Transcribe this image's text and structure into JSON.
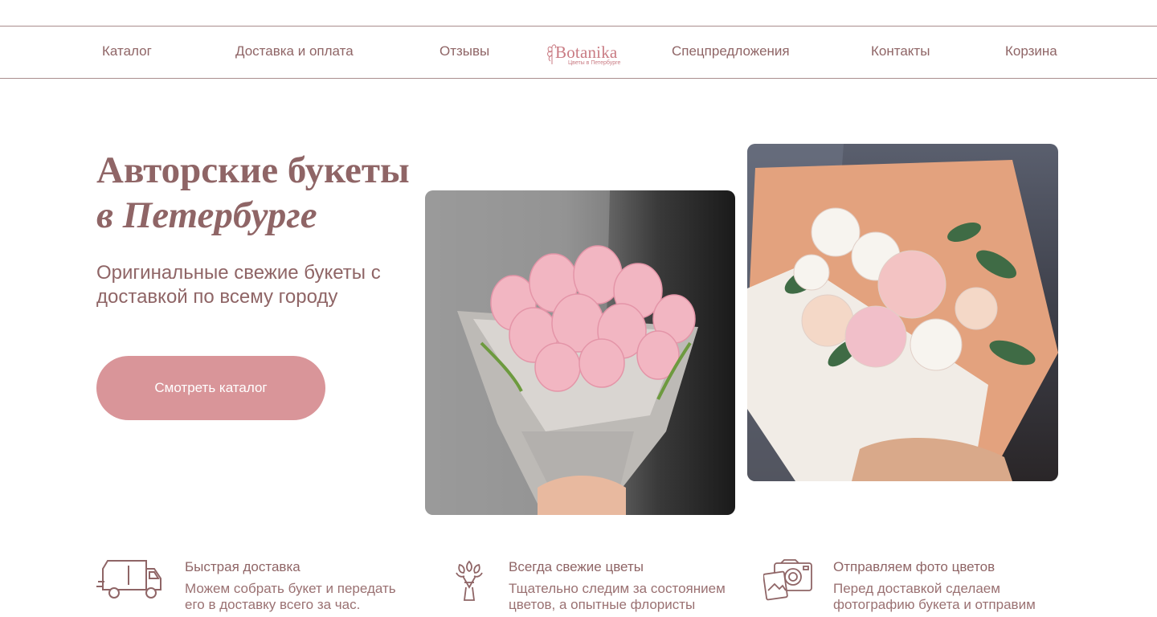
{
  "nav": {
    "catalog": "Каталог",
    "delivery": "Доставка и оплата",
    "reviews": "Отзывы",
    "offers": "Спецпредложения",
    "contacts": "Контакты",
    "cart": "Корзина"
  },
  "logo": {
    "name": "Botanika",
    "tagline": "Цветы в Петербурге",
    "icon": "flower-logo-icon"
  },
  "hero": {
    "title_line1": "Авторские букеты",
    "title_line2": "в Петербурге",
    "subtitle": "Оригинальные свежие букеты с доставкой по всему городу",
    "cta_label": "Смотреть каталог"
  },
  "features": [
    {
      "icon": "delivery-truck-icon",
      "title": "Быстрая доставка",
      "text": "Можем собрать букет и передать его в доставку всего за час."
    },
    {
      "icon": "bouquet-icon",
      "title": "Всегда свежие цветы",
      "text": "Тщательно следим за состоянием цветов, а опытные флористы"
    },
    {
      "icon": "photo-camera-icon",
      "title": "Отправляем фото цветов",
      "text": "Перед доставкой сделаем фотографию букета и отправим"
    }
  ],
  "colors": {
    "text": "#8f6566",
    "accent": "#d99599",
    "logo": "#c97b83",
    "line": "#a98d8d"
  }
}
